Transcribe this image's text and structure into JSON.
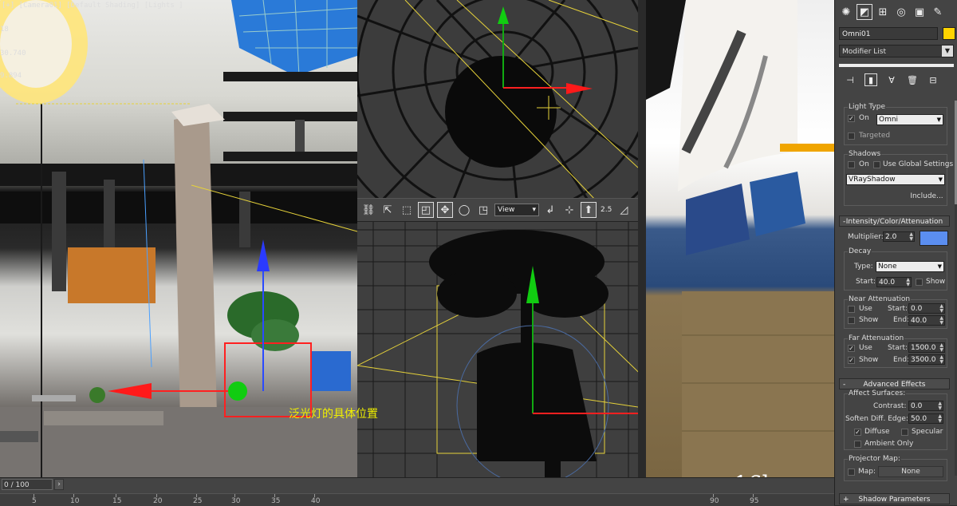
{
  "viewport_left": {
    "label": "[+] [Camera01] [Default Shading] [Lights ]",
    "stats": [
      "18",
      "30.740",
      "9.894"
    ]
  },
  "annotation": "泛光灯的具体位置",
  "figure_label": "16b",
  "toolbar": {
    "view_select": "View",
    "snap_value": "2.5",
    "icons": [
      "link-icon",
      "unlink-icon",
      "select-icon",
      "select-by-name-icon",
      "rect-region-icon",
      "window-crossing-icon",
      "move-icon",
      "rotate-icon",
      "scale-icon",
      "pivot-icon",
      "mirror-icon",
      "align-icon",
      "snap-icon"
    ]
  },
  "timeline": {
    "frame_counter": "0 / 100",
    "ticks_left": [
      5,
      10,
      15,
      20,
      25,
      30,
      35,
      40
    ],
    "ticks_right": [
      90,
      95
    ]
  },
  "panel": {
    "tabs": [
      "create-icon",
      "modify-icon",
      "hierarchy-icon",
      "motion-icon",
      "display-icon",
      "utilities-icon"
    ],
    "object_name": "Omni01",
    "object_color": "#ffd400",
    "modifier_list": "Modifier List",
    "light_type": {
      "title": "Light Type",
      "on_label": "On",
      "type_value": "Omni",
      "targeted_label": "Targeted"
    },
    "shadows": {
      "title": "Shadows",
      "on_label": "On",
      "global_label": "Use Global Settings",
      "type_value": "VRayShadow",
      "include_label": "Include..."
    },
    "intensity": {
      "title": "Intensity/Color/Attenuation",
      "multiplier_label": "Multiplier:",
      "multiplier_value": "2.0",
      "swatch_color": "#5b8ef0",
      "decay_title": "Decay",
      "type_label": "Type:",
      "type_value": "None",
      "start_label": "Start:",
      "start_value": "40.0",
      "show_label": "Show",
      "near_title": "Near Attenuation",
      "near_use": "Use",
      "near_show": "Show",
      "near_start_label": "Start:",
      "near_start": "0.0",
      "near_end_label": "End:",
      "near_end": "40.0",
      "far_title": "Far Attenuation",
      "far_use": "Use",
      "far_show": "Show",
      "far_start_label": "Start:",
      "far_start": "1500.0",
      "far_end_label": "End:",
      "far_end": "3500.0"
    },
    "advanced": {
      "title": "Advanced Effects",
      "affect_title": "Affect Surfaces:",
      "contrast_label": "Contrast:",
      "contrast_value": "0.0",
      "soften_label": "Soften Diff. Edge:",
      "soften_value": "50.0",
      "diffuse_label": "Diffuse",
      "specular_label": "Specular",
      "ambient_label": "Ambient Only",
      "projector_title": "Projector Map:",
      "map_label": "Map:",
      "map_value": "None"
    },
    "shadow_params_title": "Shadow Parameters"
  }
}
